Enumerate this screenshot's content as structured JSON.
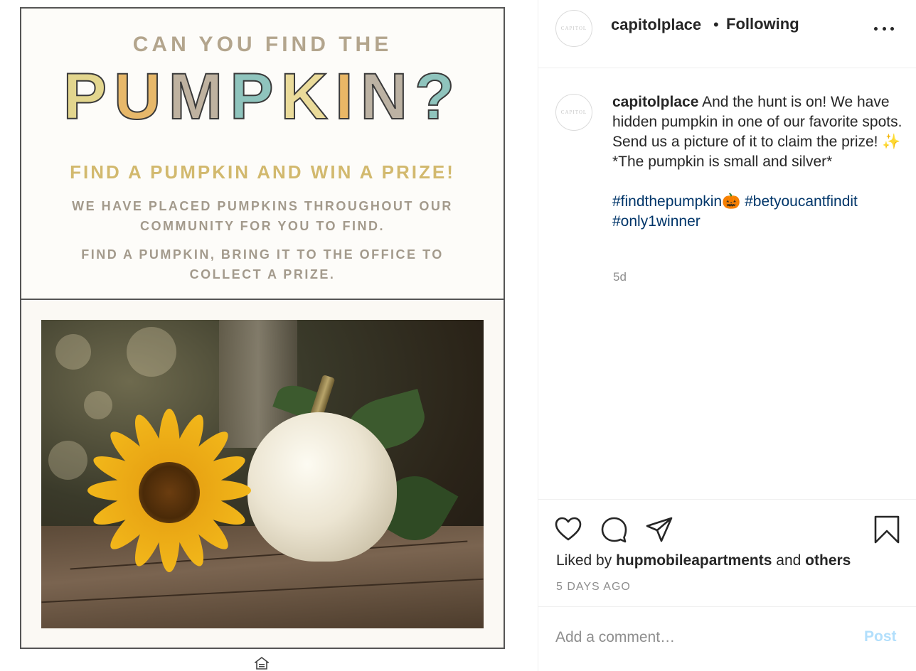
{
  "flyer": {
    "line1": "CAN YOU FIND THE",
    "title_letters": [
      {
        "ch": "P",
        "color": "#e3d68e"
      },
      {
        "ch": "U",
        "color": "#e7b86a"
      },
      {
        "ch": "M",
        "color": "#bfb2a0"
      },
      {
        "ch": "P",
        "color": "#8fc4bd"
      },
      {
        "ch": "K",
        "color": "#eadb9a"
      },
      {
        "ch": "I",
        "color": "#e9b766"
      },
      {
        "ch": "N",
        "color": "#bcb2a3"
      },
      {
        "ch": "?",
        "color": "#8fc4bd"
      }
    ],
    "subtitle": "FIND A PUMPKIN AND WIN A PRIZE!",
    "para1": "WE HAVE PLACED PUMPKINS THROUGHOUT OUR COMMUNITY FOR YOU TO FIND.",
    "para2": "FIND A PUMPKIN, BRING IT TO THE OFFICE TO COLLECT A PRIZE."
  },
  "header": {
    "avatar_text": "CAPITOL",
    "username": "capitolplace",
    "separator": "•",
    "follow_status": "Following",
    "more_icon": "more-horizontal-icon"
  },
  "caption": {
    "username": "capitolplace",
    "text": "And the hunt is on! We have hidden pumpkin in one of our favorite spots. Send us a picture of it to claim the prize! ✨",
    "line2": "*The pumpkin is small and silver*",
    "hashtags": [
      "#findthepumpkin🎃",
      "#betyoucantfindit",
      "#only1winner"
    ],
    "time": "5d"
  },
  "actions": {
    "icons": [
      "heart-icon",
      "comment-icon",
      "share-icon",
      "bookmark-icon"
    ],
    "liked_by_prefix": "Liked by",
    "liked_by_user": "hupmobileapartments",
    "liked_by_and": "and",
    "liked_by_others": "others",
    "time_ago": "5 DAYS AGO"
  },
  "comment": {
    "placeholder": "Add a comment…",
    "post_label": "Post"
  },
  "colors": {
    "link": "#003569",
    "muted": "#8e8e8e",
    "post_disabled": "#b2dffc",
    "border": "#efefef"
  }
}
